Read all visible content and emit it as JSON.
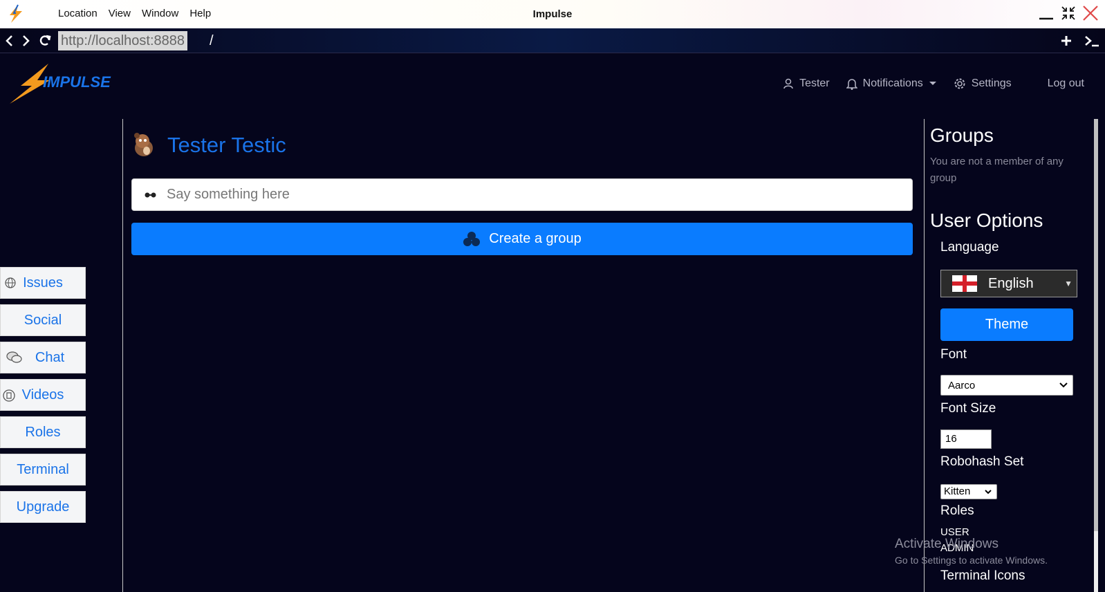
{
  "window": {
    "title": "Impulse",
    "menu": [
      "Location",
      "View",
      "Window",
      "Help"
    ]
  },
  "address": {
    "host": "http://localhost:8888",
    "path": "/"
  },
  "brand": {
    "logo_text": "IMPULSE"
  },
  "topnav": {
    "user": "Tester",
    "notifications": "Notifications",
    "settings": "Settings",
    "logout": "Log out"
  },
  "sidebar": {
    "items": [
      {
        "label": "Issues",
        "icon": "globe-icon"
      },
      {
        "label": "Social",
        "icon": ""
      },
      {
        "label": "Chat",
        "icon": "chat-bubbles-icon"
      },
      {
        "label": "Videos",
        "icon": "film-icon"
      },
      {
        "label": "Roles",
        "icon": ""
      },
      {
        "label": "Terminal",
        "icon": ""
      },
      {
        "label": "Upgrade",
        "icon": ""
      }
    ]
  },
  "main": {
    "profile_name": "Tester Testic",
    "say_placeholder": "Say something here",
    "create_group": "Create a group"
  },
  "rpanel": {
    "groups_title": "Groups",
    "groups_note": "You are not a member of any group",
    "user_options_title": "User Options",
    "language_label": "Language",
    "language_value": "English",
    "theme_button": "Theme",
    "font_label": "Font",
    "font_value": "Aarco",
    "font_size_label": "Font Size",
    "font_size_value": "16",
    "robohash_label": "Robohash Set",
    "robohash_value": "Kitten",
    "roles_label": "Roles",
    "roles": [
      "USER",
      "ADMIN"
    ],
    "terminal_icons_label": "Terminal Icons"
  },
  "watermark": {
    "line1": "Activate Windows",
    "line2": "Go to Settings to activate Windows."
  },
  "colors": {
    "accent": "#0a7cff",
    "link": "#1a73e8",
    "background": "#05051c"
  }
}
